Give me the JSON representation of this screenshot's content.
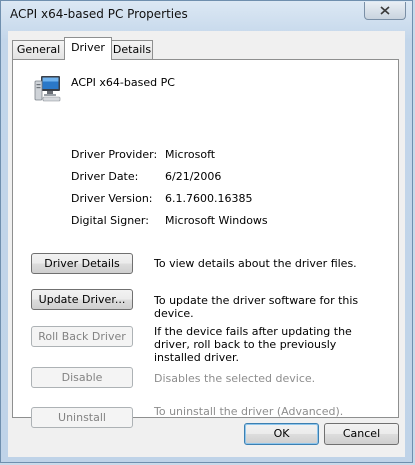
{
  "window": {
    "title": "ACPI x64-based PC Properties",
    "close_icon": "close-x-icon"
  },
  "tabs": [
    {
      "label": "General",
      "active": false
    },
    {
      "label": "Driver",
      "active": true
    },
    {
      "label": "Details",
      "active": false
    }
  ],
  "device": {
    "icon": "computer-monitor-icon",
    "name": "ACPI x64-based PC"
  },
  "properties": [
    {
      "label": "Driver Provider:",
      "value": "Microsoft"
    },
    {
      "label": "Driver Date:",
      "value": "6/21/2006"
    },
    {
      "label": "Driver Version:",
      "value": "6.1.7600.16385"
    },
    {
      "label": "Digital Signer:",
      "value": "Microsoft Windows"
    }
  ],
  "actions": [
    {
      "label": "Driver Details",
      "description": "To view details about the driver files.",
      "enabled": true
    },
    {
      "label": "Update Driver...",
      "description": "To update the driver software for this device.",
      "enabled": true
    },
    {
      "label": "Roll Back Driver",
      "description": "If the device fails after updating the driver, roll back to the previously installed driver.",
      "enabled": false
    },
    {
      "label": "Disable",
      "description": "Disables the selected device.",
      "enabled": false
    },
    {
      "label": "Uninstall",
      "description": "To uninstall the driver (Advanced).",
      "enabled": false
    }
  ],
  "footer": {
    "ok_label": "OK",
    "cancel_label": "Cancel"
  }
}
